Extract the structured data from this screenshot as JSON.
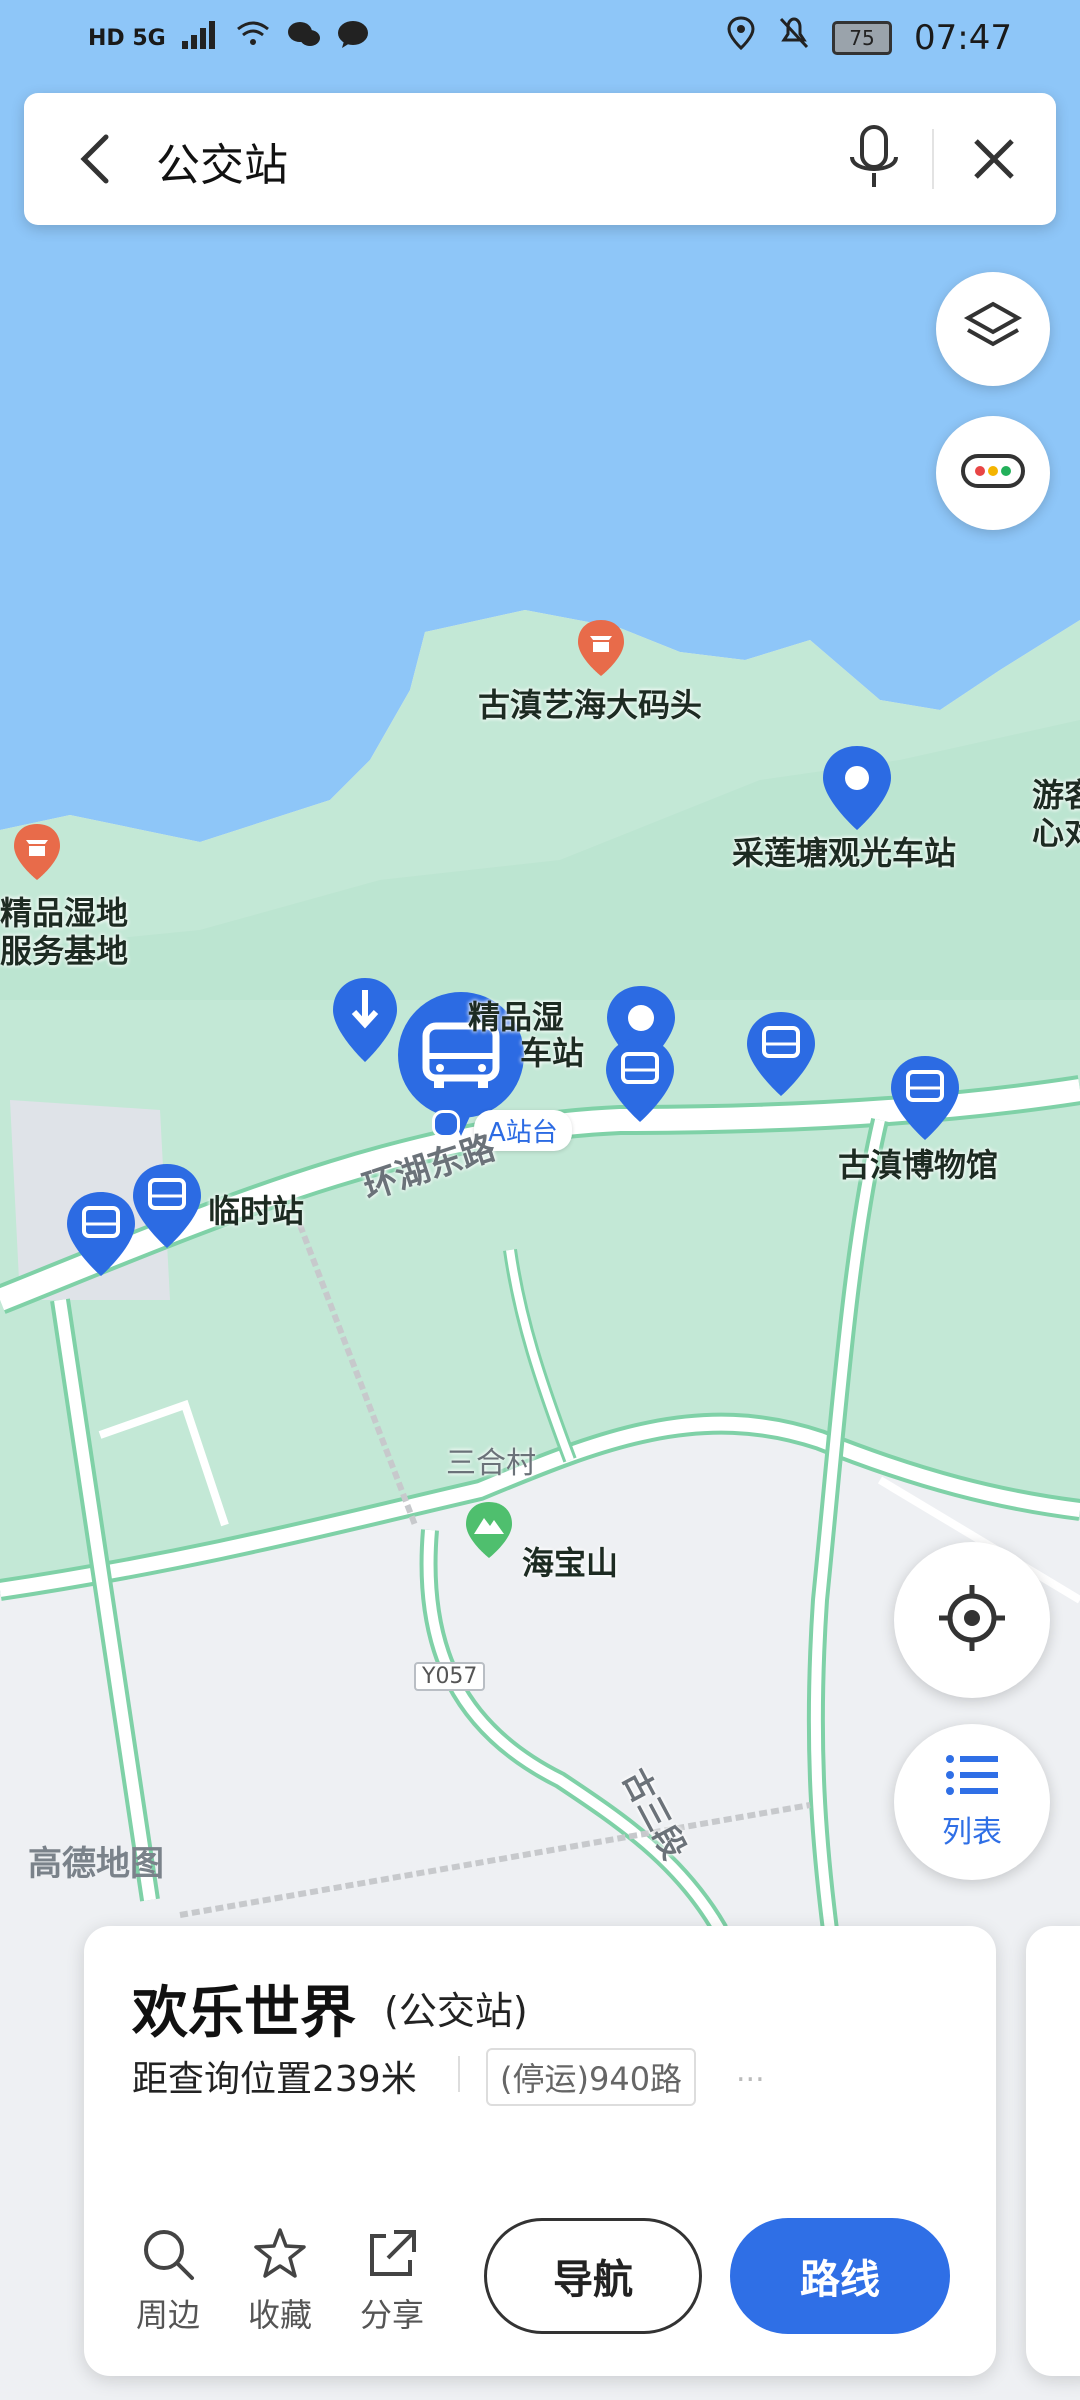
{
  "status_bar": {
    "left_text": "HD 5G",
    "battery": "75",
    "time": "07:47"
  },
  "search": {
    "query": "公交站"
  },
  "map": {
    "labels": {
      "pier": "古滇艺海大码头",
      "sightseeing_station": "采莲塘观光车站",
      "visitor_center": "游客\n心对",
      "wetland_line1": "精品湿地",
      "wetland_line2": "服务基地",
      "station_partial_line1": "精品湿",
      "station_partial_line2": "车站",
      "platform_a": "A站台",
      "road_lake": "环湖东路",
      "temp_station": "临时站",
      "museum": "古滇博物馆",
      "village": "三合村",
      "mountain": "海宝山",
      "road_code": "Y057",
      "road_section": "古三段"
    },
    "watermark": "高德地图"
  },
  "controls": {
    "list_label": "列表"
  },
  "card": {
    "name": "欢乐世界",
    "category": "(公交站)",
    "distance": "距查询位置239米",
    "route_tag": "(停运)940路",
    "more": "...",
    "actions": {
      "nearby": "周边",
      "favorite": "收藏",
      "share": "分享"
    },
    "nav_button": "导航",
    "route_button": "路线"
  },
  "colors": {
    "water": "#8ec6f8",
    "park": "#c3e8d6",
    "road": "#ffffff",
    "accent": "#2f6fe6",
    "marker": "#2c6be3"
  }
}
